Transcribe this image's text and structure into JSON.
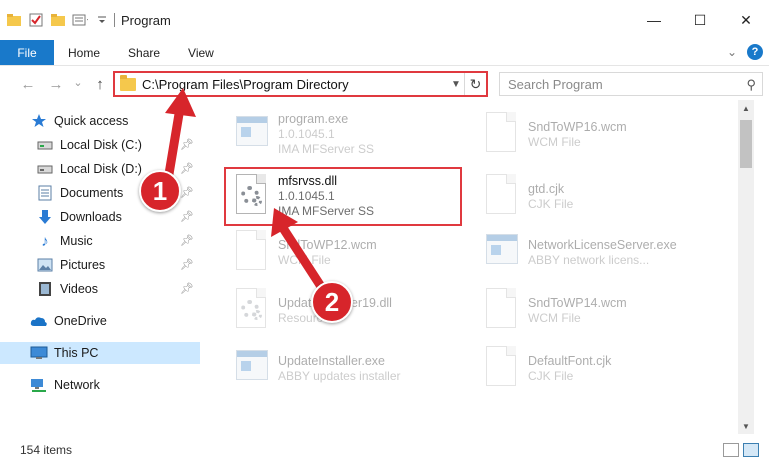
{
  "window": {
    "title": "Program",
    "minimize": "—",
    "maximize": "☐",
    "close": "✕"
  },
  "ribbon": {
    "tabs": [
      "File",
      "Home",
      "Share",
      "View"
    ],
    "help": "?"
  },
  "nav": {
    "back": "←",
    "forward": "→",
    "recent": "⌄",
    "up": "↑",
    "address": "C:\\Program Files\\Program Directory",
    "search_placeholder": "Search Program"
  },
  "sidebar": {
    "items": [
      {
        "label": "Quick access",
        "icon": "star-icon"
      },
      {
        "label": "Local Disk (C:)",
        "icon": "drive-icon",
        "pinned": true
      },
      {
        "label": "Local Disk (D:)",
        "icon": "drive-icon",
        "pinned": true
      },
      {
        "label": "Documents",
        "icon": "documents-icon",
        "pinned": true
      },
      {
        "label": "Downloads",
        "icon": "download-icon",
        "pinned": true
      },
      {
        "label": "Music",
        "icon": "music-icon",
        "pinned": true
      },
      {
        "label": "Pictures",
        "icon": "pictures-icon",
        "pinned": true
      },
      {
        "label": "Videos",
        "icon": "videos-icon",
        "pinned": true
      },
      {
        "label": "OneDrive",
        "icon": "cloud-icon"
      },
      {
        "label": "This PC",
        "icon": "computer-icon",
        "selected": true
      },
      {
        "label": "Network",
        "icon": "network-icon"
      }
    ]
  },
  "files": [
    {
      "name": "program.exe",
      "line2": "1.0.1045.1",
      "line3": "IMA MFServer SS",
      "icon": "exe-icon"
    },
    {
      "name": "SndToWP16.wcm",
      "line2": "WCM File",
      "line3": "",
      "icon": "document-icon"
    },
    {
      "name": "mfsrvss.dll",
      "line2": "1.0.1045.1",
      "line3": "IMA MFServer SS",
      "icon": "dll-icon",
      "focus": true
    },
    {
      "name": "gtd.cjk",
      "line2": "CJK File",
      "line3": "",
      "icon": "document-icon"
    },
    {
      "name": "SndToWP12.wcm",
      "line2": "WCM File",
      "line3": "",
      "icon": "document-icon"
    },
    {
      "name": "NetworkLicenseServer.exe",
      "line2": "ABBY network licens...",
      "line3": "",
      "icon": "exe-icon"
    },
    {
      "name": "UpdateInstaller19.dll",
      "line2": "Resources",
      "line3": "",
      "icon": "dll-icon"
    },
    {
      "name": "SndToWP14.wcm",
      "line2": "WCM File",
      "line3": "",
      "icon": "document-icon"
    },
    {
      "name": "UpdateInstaller.exe",
      "line2": "ABBY updates installer",
      "line3": "",
      "icon": "exe-icon"
    },
    {
      "name": "DefaultFont.cjk",
      "line2": "CJK File",
      "line3": "",
      "icon": "document-icon"
    }
  ],
  "status": {
    "count": "154 items"
  },
  "annotations": {
    "step1": "1",
    "step2": "2",
    "color": "#d7252b"
  }
}
